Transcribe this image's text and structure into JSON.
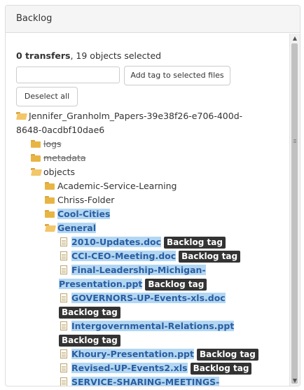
{
  "panel": {
    "title": "Backlog"
  },
  "summary": {
    "transfers": "0 transfers",
    "rest": ", 19 objects selected"
  },
  "actions": {
    "tag_input_value": "",
    "add_tag_label": "Add tag to selected files",
    "deselect_label": "Deselect all"
  },
  "tree": {
    "root_line1": "Jennifer_Granholm_Papers-39e38f26-e706-400d-",
    "root_line2": "8648-0acdbf10dae6",
    "logs": "logs",
    "metadata": "metadata",
    "objects": "objects",
    "folder1": "Academic-Service-Learning",
    "folder2": "Chriss-Folder",
    "folder3": "Cool-Cities",
    "folder4": "General",
    "files": [
      {
        "name": "2010-Updates.doc",
        "tag": "Backlog tag"
      },
      {
        "name": "CCI-CEO-Meeting.doc",
        "tag": "Backlog tag"
      },
      {
        "name_line1": "Final-Leadership-Michigan-",
        "name_line2": "Presentation.ppt",
        "tag": "Backlog tag"
      },
      {
        "name": "GOVERNORS-UP-Events-xls.doc",
        "tag": "Backlog tag"
      },
      {
        "name": "Intergovernmental-Relations.ppt",
        "tag": "Backlog tag"
      },
      {
        "name": "Khoury-Presentation.ppt",
        "tag": "Backlog tag"
      },
      {
        "name": "Revised-UP-Events2.xls",
        "tag": "Backlog tag"
      },
      {
        "name": "SERVICE-SHARING-MEETINGS-"
      }
    ]
  },
  "icons": {
    "folder": "folder-icon",
    "folder_open": "folder-open-icon",
    "file": "file-icon",
    "scroll_up": "scroll-up-arrow-icon",
    "scroll_down": "scroll-down-arrow-icon"
  },
  "colors": {
    "selection": "#b3d7f3",
    "selected_text": "#2a5ea1",
    "tag_bg": "#333333",
    "folder": "#e8b545"
  }
}
